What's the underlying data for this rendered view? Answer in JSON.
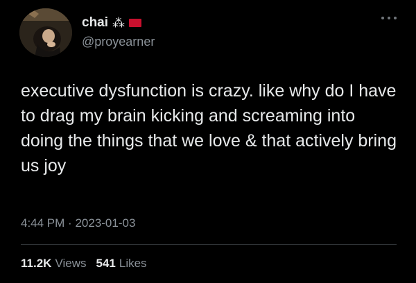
{
  "user": {
    "display_name": "chai",
    "name_glyph": "⁂",
    "flag_color": "#c8102e",
    "handle": "@proyearner",
    "avatar_icon": "profile-photo"
  },
  "tweet": {
    "text": "executive dysfunction is crazy. like why do I have to drag my brain kicking and screaming into doing the things that we love & that actively bring us joy",
    "time": "4:44 PM",
    "separator": "·",
    "date": "2023-01-03"
  },
  "stats": {
    "views_count": "11.2K",
    "views_label": "Views",
    "likes_count": "541",
    "likes_label": "Likes"
  },
  "colors": {
    "background": "#000000",
    "text_primary": "#e7e9ea",
    "text_secondary": "#8b9299",
    "divider": "#2f3336"
  }
}
